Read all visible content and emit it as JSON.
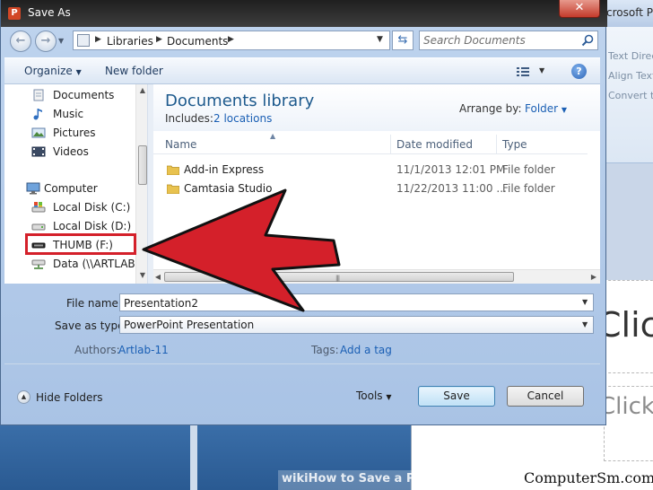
{
  "background_app": {
    "title_fragment": "crosoft Po",
    "ribbon_items": [
      "Text Direc",
      "Align Text",
      "Convert to"
    ],
    "slide_text_1": "Click",
    "slide_text_2": "Click"
  },
  "dialog": {
    "title": "Save As",
    "address": {
      "segments": [
        "Libraries",
        "Documents"
      ]
    },
    "search": {
      "placeholder": "Search Documents"
    },
    "toolbar": {
      "organize": "Organize",
      "new_folder": "New folder"
    },
    "nav": {
      "items": [
        {
          "label": "Documents",
          "icon": "documents-icon"
        },
        {
          "label": "Music",
          "icon": "music-icon"
        },
        {
          "label": "Pictures",
          "icon": "pictures-icon"
        },
        {
          "label": "Videos",
          "icon": "videos-icon"
        },
        {
          "label": "Computer",
          "icon": "computer-icon"
        },
        {
          "label": "Local Disk (C:)",
          "icon": "drive-icon"
        },
        {
          "label": "Local Disk (D:)",
          "icon": "drive-icon"
        },
        {
          "label": "THUMB (F:)",
          "icon": "usb-drive-icon"
        },
        {
          "label": "Data (\\\\ARTLAB)",
          "icon": "network-drive-icon"
        }
      ]
    },
    "library": {
      "title": "Documents library",
      "includes_label": "Includes:",
      "locations": "2 locations",
      "arrange_label": "Arrange by:",
      "arrange_value": "Folder"
    },
    "columns": [
      "Name",
      "Date modified",
      "Type"
    ],
    "files": [
      {
        "name": "Add-in Express",
        "date": "11/1/2013 12:01 PM",
        "type": "File folder"
      },
      {
        "name": "Camtasia Studio",
        "date": "11/22/2013 11:00 ...",
        "type": "File folder"
      }
    ],
    "form": {
      "file_name_label": "File name:",
      "file_name_value": "Presentation2",
      "save_type_label": "Save as type:",
      "save_type_value": "PowerPoint Presentation",
      "authors_label": "Authors:",
      "authors_value": "Artlab-11",
      "tags_label": "Tags:",
      "tags_value": "Add a tag"
    },
    "footer": {
      "hide_folders": "Hide Folders",
      "tools": "Tools",
      "save": "Save",
      "cancel": "Cancel"
    }
  },
  "overlay": {
    "wiki_caption": "wikiHow to Save a PowerPoint Present",
    "watermark": "ComputerSm.com",
    "annotation_color": "#d4202a"
  }
}
